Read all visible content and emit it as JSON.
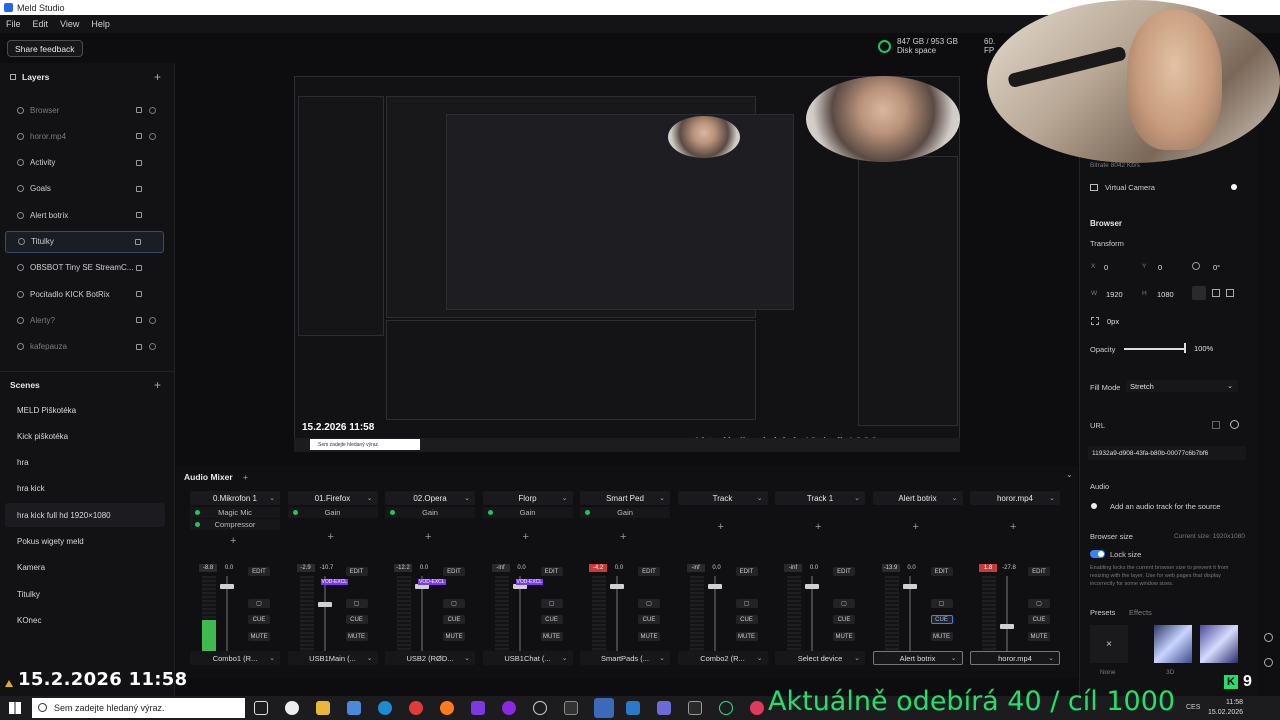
{
  "window": {
    "title": "Meld Studio"
  },
  "menu": [
    "File",
    "Edit",
    "View",
    "Help"
  ],
  "toolbar": {
    "share_feedback": "Share feedback",
    "disk_value": "847 GB / 953 GB",
    "disk_label": "Disk space",
    "fps_value": "60.",
    "fps_label": "FP"
  },
  "layers": {
    "title": "Layers",
    "items": [
      {
        "name": "Browser",
        "dim": true
      },
      {
        "name": "horor.mp4",
        "dim": true
      },
      {
        "name": "Activity",
        "dim": false
      },
      {
        "name": "Goals",
        "dim": false
      },
      {
        "name": "Alert botrix",
        "dim": false
      },
      {
        "name": "Titulky",
        "dim": false,
        "selected": true
      },
      {
        "name": "OBSBOT Tiny SE StreamC...",
        "dim": false
      },
      {
        "name": "Pocitadlo KICK BotRix",
        "dim": false
      },
      {
        "name": "Alerty?",
        "dim": true
      },
      {
        "name": "kafepauza",
        "dim": true
      }
    ]
  },
  "scenes": {
    "title": "Scenes",
    "items": [
      "MELD Piškotéka",
      "Kick piškotéka",
      "hra",
      "hra kick",
      "hra kick full hd 1920×1080",
      "Pokus wigety meld",
      "Kamera",
      "Titulky",
      "KOnec"
    ],
    "selected_index": 4
  },
  "mixer": {
    "title": "Audio Mixer",
    "strips": [
      {
        "name": "0.Mikrofon 1",
        "fx": [
          "Magic Mic",
          "Compressor"
        ],
        "peak": "-8.8",
        "gain": "0.0",
        "level": 0.45,
        "fader": 0.1,
        "device": "Combo1 (R...",
        "peak_red": false,
        "vod": false,
        "cue_on": false
      },
      {
        "name": "01.Firefox",
        "fx": [
          "Gain"
        ],
        "peak": "-2.9",
        "gain": "-10.7",
        "level": 0.05,
        "fader": 0.32,
        "device": "USB1Main (...",
        "peak_red": false,
        "vod": true,
        "cue_on": false
      },
      {
        "name": "02.Opera",
        "fx": [
          "Gain"
        ],
        "peak": "-12.2",
        "gain": "0.0",
        "level": 0.05,
        "fader": 0.1,
        "device": "USB2 (RØD...",
        "peak_red": false,
        "vod": true,
        "cue_on": false
      },
      {
        "name": "Florp",
        "fx": [
          "Gain"
        ],
        "peak": "-inf",
        "gain": "0.0",
        "level": 0.0,
        "fader": 0.1,
        "device": "USB1Chat (...",
        "peak_red": false,
        "vod": true,
        "cue_on": false
      },
      {
        "name": "Smart Ped",
        "fx": [
          "Gain"
        ],
        "peak": "-4.2",
        "gain": "0.0",
        "level": 0.0,
        "fader": 0.1,
        "device": "SmartPads (...",
        "peak_red": true,
        "vod": false,
        "cue_on": false
      },
      {
        "name": "Track",
        "fx": [],
        "peak": "-inf",
        "gain": "0.0",
        "level": 0.0,
        "fader": 0.1,
        "device": "Combo2 (R...",
        "peak_red": false,
        "vod": false,
        "cue_on": false
      },
      {
        "name": "Track 1",
        "fx": [],
        "peak": "-inf",
        "gain": "0.0",
        "level": 0.0,
        "fader": 0.1,
        "device": "Select device",
        "peak_red": false,
        "vod": false,
        "cue_on": false
      },
      {
        "name": "Alert botrix",
        "fx": [],
        "peak": "-13.9",
        "gain": "0.0",
        "level": 0.0,
        "fader": 0.1,
        "device": "Alert botrix",
        "peak_red": false,
        "vod": false,
        "cue_on": true,
        "outline": true
      },
      {
        "name": "horor.mp4",
        "fx": [],
        "peak": "1.8",
        "gain": "-27.8",
        "level": 0.0,
        "fader": 0.6,
        "device": "horor.mp4",
        "peak_red": true,
        "vod": false,
        "cue_on": false,
        "outline": true
      }
    ],
    "edit_label": "EDIT",
    "cue_label": "CUE",
    "mute_label": "MUTE",
    "vod_label": "VOD-EXCL"
  },
  "props": {
    "virtual_camera": "Virtual Camera",
    "bitrate": "Bitrate  8042 Kb/s",
    "section": "Browser",
    "transform": "Transform",
    "x_label": "X",
    "x_value": "0",
    "y_label": "Y",
    "y_value": "0",
    "rot_value": "0°",
    "w_label": "W",
    "w_value": "1920",
    "h_label": "H",
    "h_value": "1080",
    "crop_value": "0px",
    "opacity_label": "Opacity",
    "opacity_value": "100%",
    "opacity_level": 1.0,
    "fill_mode_label": "Fill Mode",
    "fill_mode_value": "Stretch",
    "url_label": "URL",
    "url_value": "11932a9-d908-43fa-b80b-00077c6b7bf6",
    "audio_label": "Audio",
    "add_audio": "Add an audio track for the source",
    "browser_size": "Browser size",
    "current_size": "Current size: 1920x1080",
    "lock_size": "Lock size",
    "lock_desc": "Enabling locks the current browser size to prevent it from resizing with the layer. Use for web pages that display incorrectly for some window sizes.",
    "presets": "Presets",
    "effects": "Effects",
    "none_label": "None",
    "threed_label": "3D"
  },
  "overlay": {
    "datetime": "15.2.2026 11:58",
    "subs": "Aktuálně odebírá 40 / cíl 1000",
    "kick_count": "9"
  },
  "taskbar": {
    "search_placeholder": "Sem zadejte hledaný výraz.",
    "time": "11:58",
    "date": "15.02.2026",
    "lang": "CES"
  },
  "colors": {
    "accent_green": "#22e06a",
    "meter_green": "#3fb950",
    "peak_red": "#c93a3a",
    "select_blue": "#3b82f6"
  }
}
